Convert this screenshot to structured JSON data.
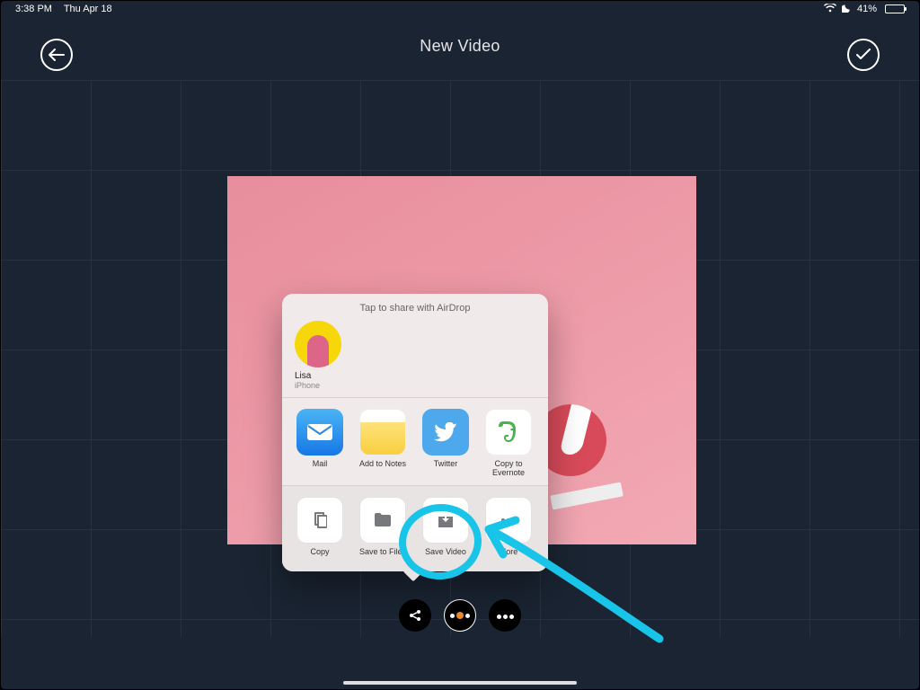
{
  "status": {
    "time": "3:38 PM",
    "date": "Thu Apr 18",
    "battery_pct": "41%"
  },
  "header": {
    "title": "New Video"
  },
  "sheet": {
    "airdrop_title": "Tap to share with AirDrop",
    "contact": {
      "name": "Lisa",
      "device": "iPhone"
    },
    "apps": [
      {
        "label": "Mail",
        "kind": "mail"
      },
      {
        "label": "Add to Notes",
        "kind": "notes"
      },
      {
        "label": "Twitter",
        "kind": "twitter"
      },
      {
        "label": "Copy to Evernote",
        "kind": "evernote"
      }
    ],
    "actions": [
      {
        "label": "Copy",
        "icon": "copy"
      },
      {
        "label": "Save to Files",
        "icon": "folder"
      },
      {
        "label": "Save Video",
        "icon": "download"
      },
      {
        "label": "More",
        "icon": "more"
      }
    ]
  },
  "annotation": {
    "target": "Save Video"
  }
}
